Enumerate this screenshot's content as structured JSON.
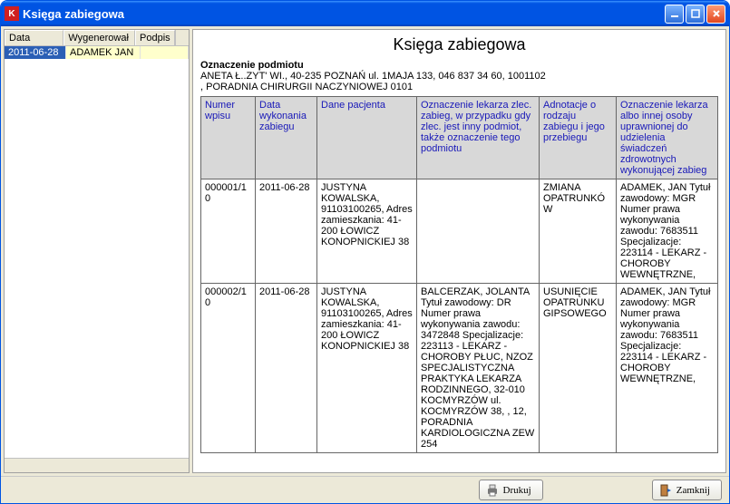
{
  "window": {
    "title": "Księga zabiegowa"
  },
  "left": {
    "headers": {
      "data": "Data",
      "wygenerowal": "Wygenerował",
      "podpis": "Podpis"
    },
    "rows": [
      {
        "data": "2011-06-28",
        "wygenerowal": "ADAMEK JAN",
        "podpis": ""
      }
    ]
  },
  "report": {
    "title": "Księga zabiegowa",
    "subject_label": "Oznaczenie podmiotu",
    "subject_line1": "ANETA Ł..ZYT' WI., 40-235 POZNAŃ ul. 1MAJA 133, 046 837 34 60, 1001102",
    "subject_line2": ", PORADNIA CHIRURGII NACZYNIOWEJ 0101",
    "columns": {
      "c1": "Numer wpisu",
      "c2": "Data wykonania zabiegu",
      "c3": "Dane pacjenta",
      "c4": "Oznaczenie lekarza zlec. zabieg, w przypadku gdy zlec. jest inny podmiot, także oznaczenie tego podmiotu",
      "c5": "Adnotacje o rodzaju zabiegu i jego przebiegu",
      "c6": "Oznaczenie lekarza albo innej osoby uprawnionej do udzielenia świadczeń zdrowotnych wykonującej zabieg"
    },
    "rows": [
      {
        "c1": "000001/10",
        "c2": "2011-06-28",
        "c3": "JUSTYNA KOWALSKA, 91103100265, Adres zamieszkania: 41-200 ŁOWICZ KONOPNICKIEJ 38",
        "c4": "",
        "c5": "ZMIANA OPATRUNKÓW",
        "c6": "ADAMEK, JAN Tytuł zawodowy: MGR Numer prawa wykonywania zawodu: 7683511 Specjalizacje: 223114 - LEKARZ - CHOROBY WEWNĘTRZNE,"
      },
      {
        "c1": "000002/10",
        "c2": "2011-06-28",
        "c3": "JUSTYNA KOWALSKA, 91103100265, Adres zamieszkania: 41-200 ŁOWICZ KONOPNICKIEJ 38",
        "c4": "BALCERZAK, JOLANTA Tytuł zawodowy: DR Numer prawa wykonywania zawodu: 3472848 Specjalizacje: 223113 - LEKARZ - CHOROBY PŁUC, NZOZ SPECJALISTYCZNA PRAKTYKA LEKARZA RODZINNEGO, 32-010 KOCMYRZÓW ul. KOCMYRZÓW 38, , 12, PORADNIA KARDIOLOGICZNA ZEW 254",
        "c5": "USUNIĘCIE OPATRUNKU GIPSOWEGO",
        "c6": "ADAMEK, JAN Tytuł zawodowy: MGR Numer prawa wykonywania zawodu: 7683511 Specjalizacje: 223114 - LEKARZ - CHOROBY WEWNĘTRZNE,"
      }
    ]
  },
  "footer": {
    "print": "Drukuj",
    "close": "Zamknij"
  }
}
